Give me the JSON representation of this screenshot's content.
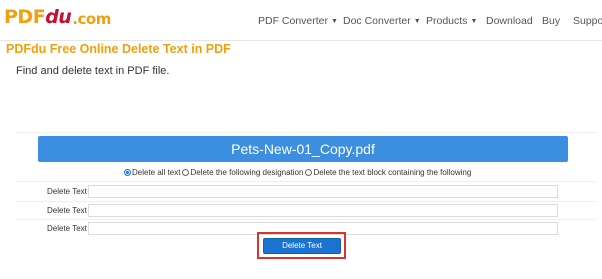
{
  "header": {
    "logo": {
      "part1": "PDF",
      "part2": "du",
      "part3": ".com"
    },
    "nav": [
      {
        "label": "PDF Converter",
        "dropdown": true
      },
      {
        "label": "Doc Converter",
        "dropdown": true
      },
      {
        "label": "Products",
        "dropdown": true
      },
      {
        "label": "Download",
        "dropdown": false
      },
      {
        "label": "Buy",
        "dropdown": false
      },
      {
        "label": "Suppor",
        "dropdown": false
      }
    ],
    "caret_icon": "caret-down-icon"
  },
  "page": {
    "title": "PDFdu Free Online Delete Text in PDF",
    "subtitle": "Find and delete text in PDF file."
  },
  "file": {
    "name": "Pets-New-01_Copy.pdf"
  },
  "options": {
    "items": [
      {
        "label": "Delete all text",
        "checked": true
      },
      {
        "label": "Delete the following designation",
        "checked": false
      },
      {
        "label": "Delete the text block containing the following",
        "checked": false
      }
    ]
  },
  "fields": [
    {
      "label": "Delete Text",
      "value": ""
    },
    {
      "label": "Delete Text",
      "value": ""
    },
    {
      "label": "Delete Text",
      "value": ""
    }
  ],
  "action": {
    "button_label": "Delete Text"
  },
  "colors": {
    "brand_orange": "#f0a010",
    "brand_red": "#c8102e",
    "file_bar": "#3b8ee0",
    "button": "#1a73d0",
    "highlight": "#d9342b"
  }
}
